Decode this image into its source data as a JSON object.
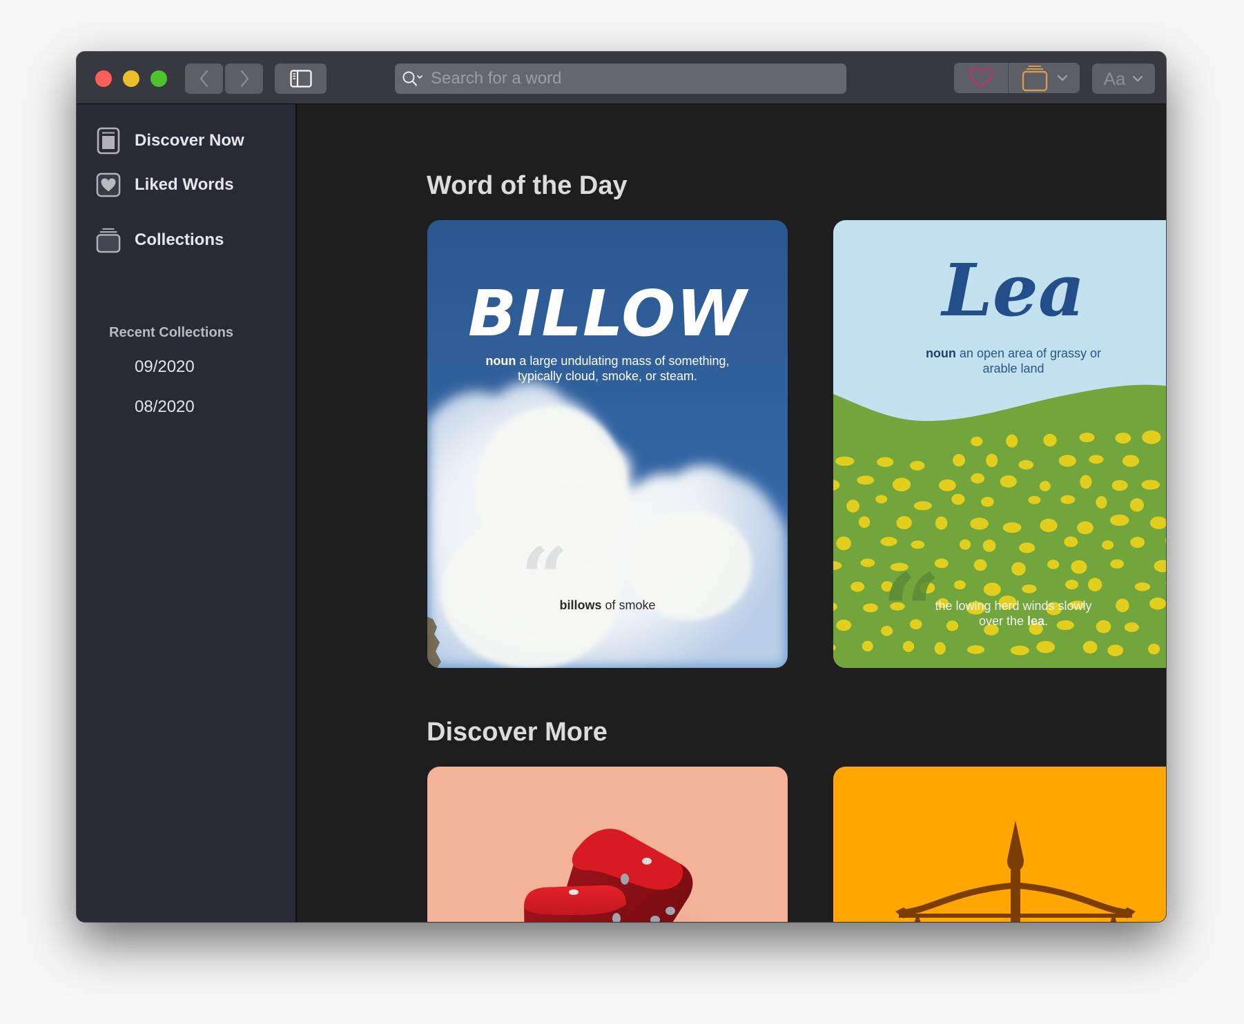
{
  "window": {
    "traffic_lights": [
      "close",
      "minimize",
      "zoom"
    ]
  },
  "toolbar": {
    "back_icon": "chevron-left-icon",
    "forward_icon": "chevron-right-icon",
    "sidebar_toggle_icon": "sidebar-icon",
    "search": {
      "placeholder": "Search for a word",
      "value": "",
      "icon": "search-icon"
    },
    "like_icon": "heart-icon",
    "collection_icon": "collection-stack-icon",
    "font_button_label": "Aa",
    "colors": {
      "heart": "#b3376c",
      "collection": "#d79a52"
    }
  },
  "sidebar": {
    "items": [
      {
        "label": "Discover Now",
        "icon": "discover-icon"
      },
      {
        "label": "Liked Words",
        "icon": "heart-square-icon"
      },
      {
        "label": "Collections",
        "icon": "collections-icon"
      }
    ],
    "recent_heading": "Recent Collections",
    "recent": [
      {
        "label": "09/2020"
      },
      {
        "label": "08/2020"
      }
    ]
  },
  "main": {
    "word_of_day_title": "Word of the Day",
    "discover_more_title": "Discover More",
    "word_cards": [
      {
        "word": "BILLOW",
        "pos": "noun",
        "definition_line1": " a large undulating mass of something,",
        "definition_line2": "typically cloud, smoke, or steam.",
        "example_bold": "billows",
        "example_rest": " of smoke",
        "colors": {
          "sky": "#2e5c97",
          "text": "#ffffff"
        }
      },
      {
        "word": "Lea",
        "pos": "noun",
        "definition_line1": " an open area of grassy or",
        "definition_line2": "arable land",
        "example_line1": "the lowing herd winds slowly",
        "example_line2_pre": "over the ",
        "example_bold": "lea",
        "example_post": ".",
        "colors": {
          "sky": "#c1e1ee",
          "grass": "#72a53c",
          "flowers": "#e2cf1d",
          "word": "#234e89"
        }
      }
    ],
    "discover_cards": [
      {
        "image": "dice-illustration",
        "bg": "#f4b399"
      },
      {
        "image": "scales-illustration",
        "bg": "#ffa600"
      }
    ]
  }
}
